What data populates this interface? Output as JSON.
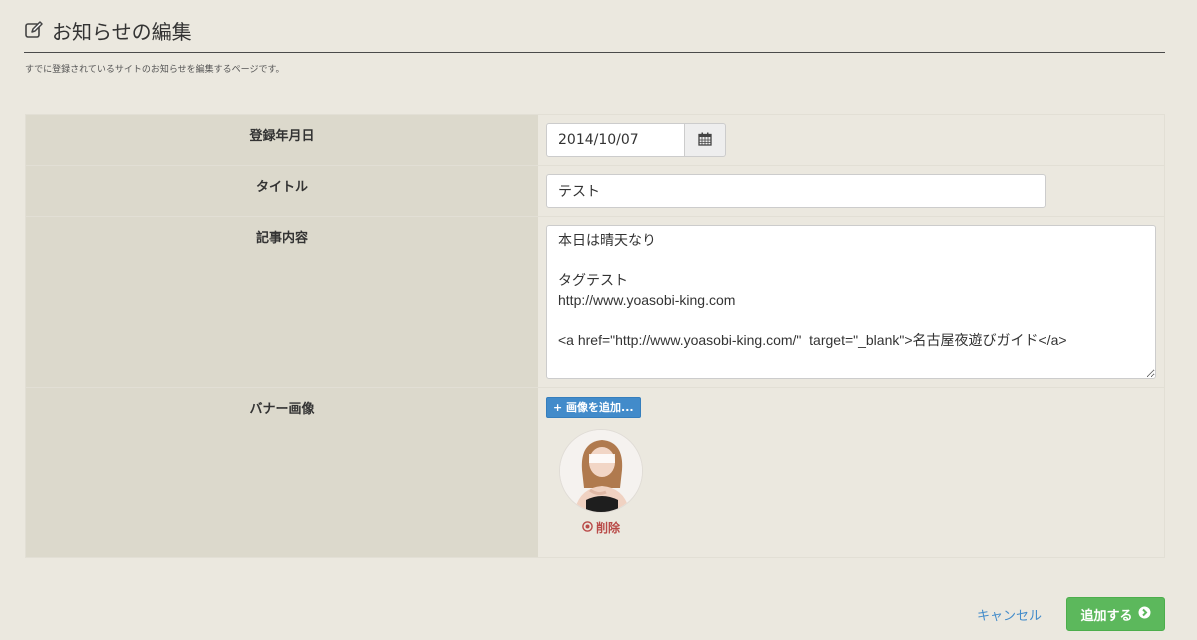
{
  "header": {
    "title": "お知らせの編集",
    "subtitle": "すでに登録されているサイトのお知らせを編集するページです。"
  },
  "form": {
    "date": {
      "label": "登録年月日",
      "value": "2014/10/07"
    },
    "title": {
      "label": "タイトル",
      "value": "テスト"
    },
    "body": {
      "label": "記事内容",
      "value": "本日は晴天なり\n\nタグテスト\nhttp://www.yoasobi-king.com\n\n<a href=\"http://www.yoasobi-king.com/\"  target=\"_blank\">名古屋夜遊びガイド</a>"
    },
    "banner": {
      "label": "バナー画像",
      "add_button": "+ 画像を追加...",
      "delete_label": "削除"
    }
  },
  "actions": {
    "cancel_label": "キャンセル",
    "submit_label": "追加する"
  },
  "colors": {
    "background": "#ebe8df",
    "label_bg": "#dcd9cc",
    "primary": "#428bca",
    "success": "#5cb85c",
    "danger": "#b94a48"
  },
  "icons": [
    "edit-icon",
    "calendar-icon",
    "remove-circle-icon",
    "arrow-circle-right-icon"
  ]
}
